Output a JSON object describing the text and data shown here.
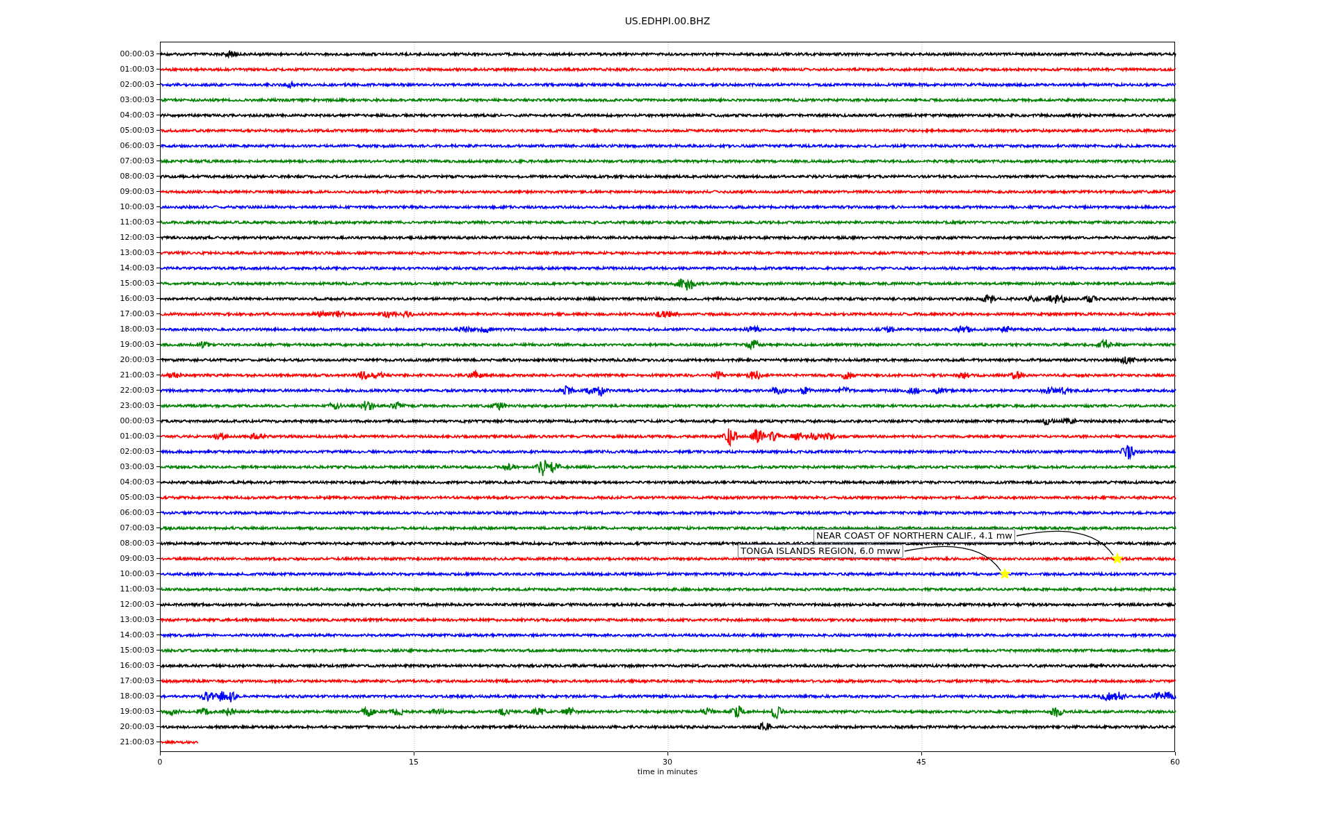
{
  "title": "US.EDHPI.00.BHZ",
  "x_axis": {
    "label": "time in minutes",
    "ticks": [
      "0",
      "15",
      "30",
      "45",
      "60"
    ]
  },
  "rows": [
    {
      "label": "00:00:03",
      "color": "#000000",
      "partial": false
    },
    {
      "label": "01:00:03",
      "color": "#ff0000",
      "partial": false
    },
    {
      "label": "02:00:03",
      "color": "#0000ff",
      "partial": false
    },
    {
      "label": "03:00:03",
      "color": "#008000",
      "partial": false
    },
    {
      "label": "04:00:03",
      "color": "#000000",
      "partial": false
    },
    {
      "label": "05:00:03",
      "color": "#ff0000",
      "partial": false
    },
    {
      "label": "06:00:03",
      "color": "#0000ff",
      "partial": false
    },
    {
      "label": "07:00:03",
      "color": "#008000",
      "partial": false
    },
    {
      "label": "08:00:03",
      "color": "#000000",
      "partial": false
    },
    {
      "label": "09:00:03",
      "color": "#ff0000",
      "partial": false
    },
    {
      "label": "10:00:03",
      "color": "#0000ff",
      "partial": false
    },
    {
      "label": "11:00:03",
      "color": "#008000",
      "partial": false
    },
    {
      "label": "12:00:03",
      "color": "#000000",
      "partial": false
    },
    {
      "label": "13:00:03",
      "color": "#ff0000",
      "partial": false
    },
    {
      "label": "14:00:03",
      "color": "#0000ff",
      "partial": false
    },
    {
      "label": "15:00:03",
      "color": "#008000",
      "partial": false
    },
    {
      "label": "16:00:03",
      "color": "#000000",
      "partial": false
    },
    {
      "label": "17:00:03",
      "color": "#ff0000",
      "partial": false
    },
    {
      "label": "18:00:03",
      "color": "#0000ff",
      "partial": false
    },
    {
      "label": "19:00:03",
      "color": "#008000",
      "partial": false
    },
    {
      "label": "20:00:03",
      "color": "#000000",
      "partial": false
    },
    {
      "label": "21:00:03",
      "color": "#ff0000",
      "partial": false
    },
    {
      "label": "22:00:03",
      "color": "#0000ff",
      "partial": false
    },
    {
      "label": "23:00:03",
      "color": "#008000",
      "partial": false
    },
    {
      "label": "00:00:03",
      "color": "#000000",
      "partial": false
    },
    {
      "label": "01:00:03",
      "color": "#ff0000",
      "partial": false
    },
    {
      "label": "02:00:03",
      "color": "#0000ff",
      "partial": false
    },
    {
      "label": "03:00:03",
      "color": "#008000",
      "partial": false
    },
    {
      "label": "04:00:03",
      "color": "#000000",
      "partial": false
    },
    {
      "label": "05:00:03",
      "color": "#ff0000",
      "partial": false
    },
    {
      "label": "06:00:03",
      "color": "#0000ff",
      "partial": false
    },
    {
      "label": "07:00:03",
      "color": "#008000",
      "partial": false
    },
    {
      "label": "08:00:03",
      "color": "#000000",
      "partial": false
    },
    {
      "label": "09:00:03",
      "color": "#ff0000",
      "partial": false,
      "annotation": "NEAR COAST OF NORTHERN CALIF., 4.1 mw"
    },
    {
      "label": "10:00:03",
      "color": "#0000ff",
      "partial": false,
      "annotation": "TONGA ISLANDS REGION, 6.0 mww"
    },
    {
      "label": "11:00:03",
      "color": "#008000",
      "partial": false
    },
    {
      "label": "12:00:03",
      "color": "#000000",
      "partial": false
    },
    {
      "label": "13:00:03",
      "color": "#ff0000",
      "partial": false
    },
    {
      "label": "14:00:03",
      "color": "#0000ff",
      "partial": false
    },
    {
      "label": "15:00:03",
      "color": "#008000",
      "partial": false
    },
    {
      "label": "16:00:03",
      "color": "#000000",
      "partial": false
    },
    {
      "label": "17:00:03",
      "color": "#ff0000",
      "partial": false
    },
    {
      "label": "18:00:03",
      "color": "#0000ff",
      "partial": false
    },
    {
      "label": "19:00:03",
      "color": "#008000",
      "partial": false
    },
    {
      "label": "20:00:03",
      "color": "#000000",
      "partial": false
    },
    {
      "label": "21:00:03",
      "color": "#ff0000",
      "partial": true
    }
  ]
}
